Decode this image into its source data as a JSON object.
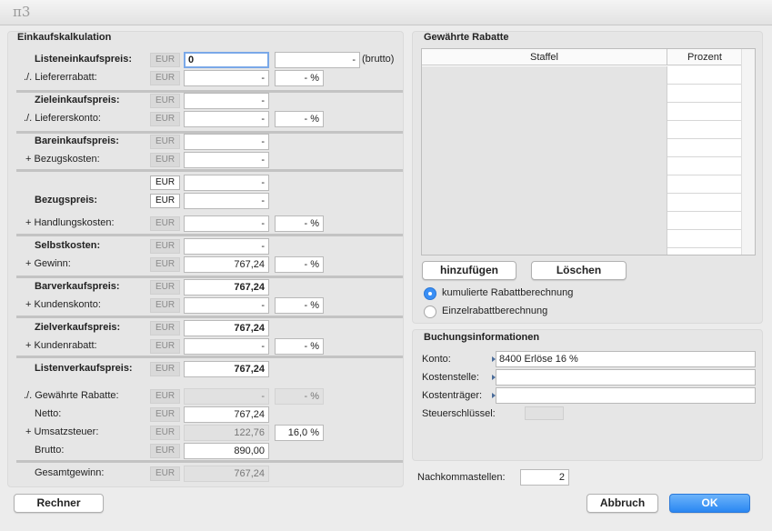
{
  "app": {
    "logo": "π3"
  },
  "kalk": {
    "title": "Einkaufskalkulation",
    "rows": [
      {
        "label": "Listeneinkaufspreis:",
        "bold": true,
        "cur": "EUR",
        "value": "0",
        "pct": "-",
        "pct_suffix": "(brutto)"
      },
      {
        "label": "./. Liefererrabatt:",
        "cur": "EUR",
        "value": "-",
        "pct": "- %"
      },
      {
        "label": "Zieleinkaufspreis:",
        "bold": true,
        "cur": "EUR",
        "value": "-"
      },
      {
        "label": "./. Liefererskonto:",
        "cur": "EUR",
        "value": "-",
        "pct": "- %"
      },
      {
        "label": "Bareinkaufspreis:",
        "bold": true,
        "cur": "EUR",
        "value": "-"
      },
      {
        "label": "+ Bezugskosten:",
        "cur": "EUR",
        "value": "-"
      },
      {
        "label": "",
        "cur": "EUR",
        "value": "-"
      },
      {
        "label": "Bezugspreis:",
        "bold": true,
        "cur": "EUR",
        "value": "-"
      },
      {
        "label": "+ Handlungskosten:",
        "cur": "EUR",
        "value": "-",
        "pct": "- %"
      },
      {
        "label": "Selbstkosten:",
        "bold": true,
        "cur": "EUR",
        "value": "-"
      },
      {
        "label": "+ Gewinn:",
        "cur": "EUR",
        "value": "767,24",
        "pct": "- %"
      },
      {
        "label": "Barverkaufspreis:",
        "bold": true,
        "cur": "EUR",
        "value": "767,24"
      },
      {
        "label": "+ Kundenskonto:",
        "cur": "EUR",
        "value": "-",
        "pct": "- %"
      },
      {
        "label": "Zielverkaufspreis:",
        "bold": true,
        "cur": "EUR",
        "value": "767,24"
      },
      {
        "label": "+ Kundenrabatt:",
        "cur": "EUR",
        "value": "-",
        "pct": "- %"
      },
      {
        "label": "Listenverkaufspreis:",
        "bold": true,
        "cur": "EUR",
        "value": "767,24"
      },
      {
        "label": "./. Gewährte Rabatte:",
        "cur": "EUR",
        "value": "-",
        "pct": "- %"
      },
      {
        "label": "Netto:",
        "cur": "EUR",
        "value": "767,24"
      },
      {
        "label": "+ Umsatzsteuer:",
        "cur": "EUR",
        "value": "122,76",
        "pct": "16,0 %"
      },
      {
        "label": "Brutto:",
        "cur": "EUR",
        "value": "890,00"
      },
      {
        "label": "Gesamtgewinn:",
        "cur": "EUR",
        "value": "767,24"
      }
    ]
  },
  "rabatte": {
    "title": "Gewährte Rabatte",
    "col_staffel": "Staffel",
    "col_prozent": "Prozent",
    "add_label": "hinzufügen",
    "delete_label": "Löschen",
    "radio_kumuliert": "kumulierte Rabattberechnung",
    "radio_einzel": "Einzelrabattberechnung"
  },
  "buchung": {
    "title": "Buchungsinformationen",
    "konto_label": "Konto:",
    "konto_value": "8400 Erlöse 16 %",
    "kostenstelle_label": "Kostenstelle:",
    "kostentraeger_label": "Kostenträger:",
    "steuer_label": "Steuerschlüssel:"
  },
  "nachkomma": {
    "label": "Nachkommastellen:",
    "value": "2"
  },
  "buttons": {
    "rechner": "Rechner",
    "abbruch": "Abbruch",
    "ok": "OK"
  }
}
